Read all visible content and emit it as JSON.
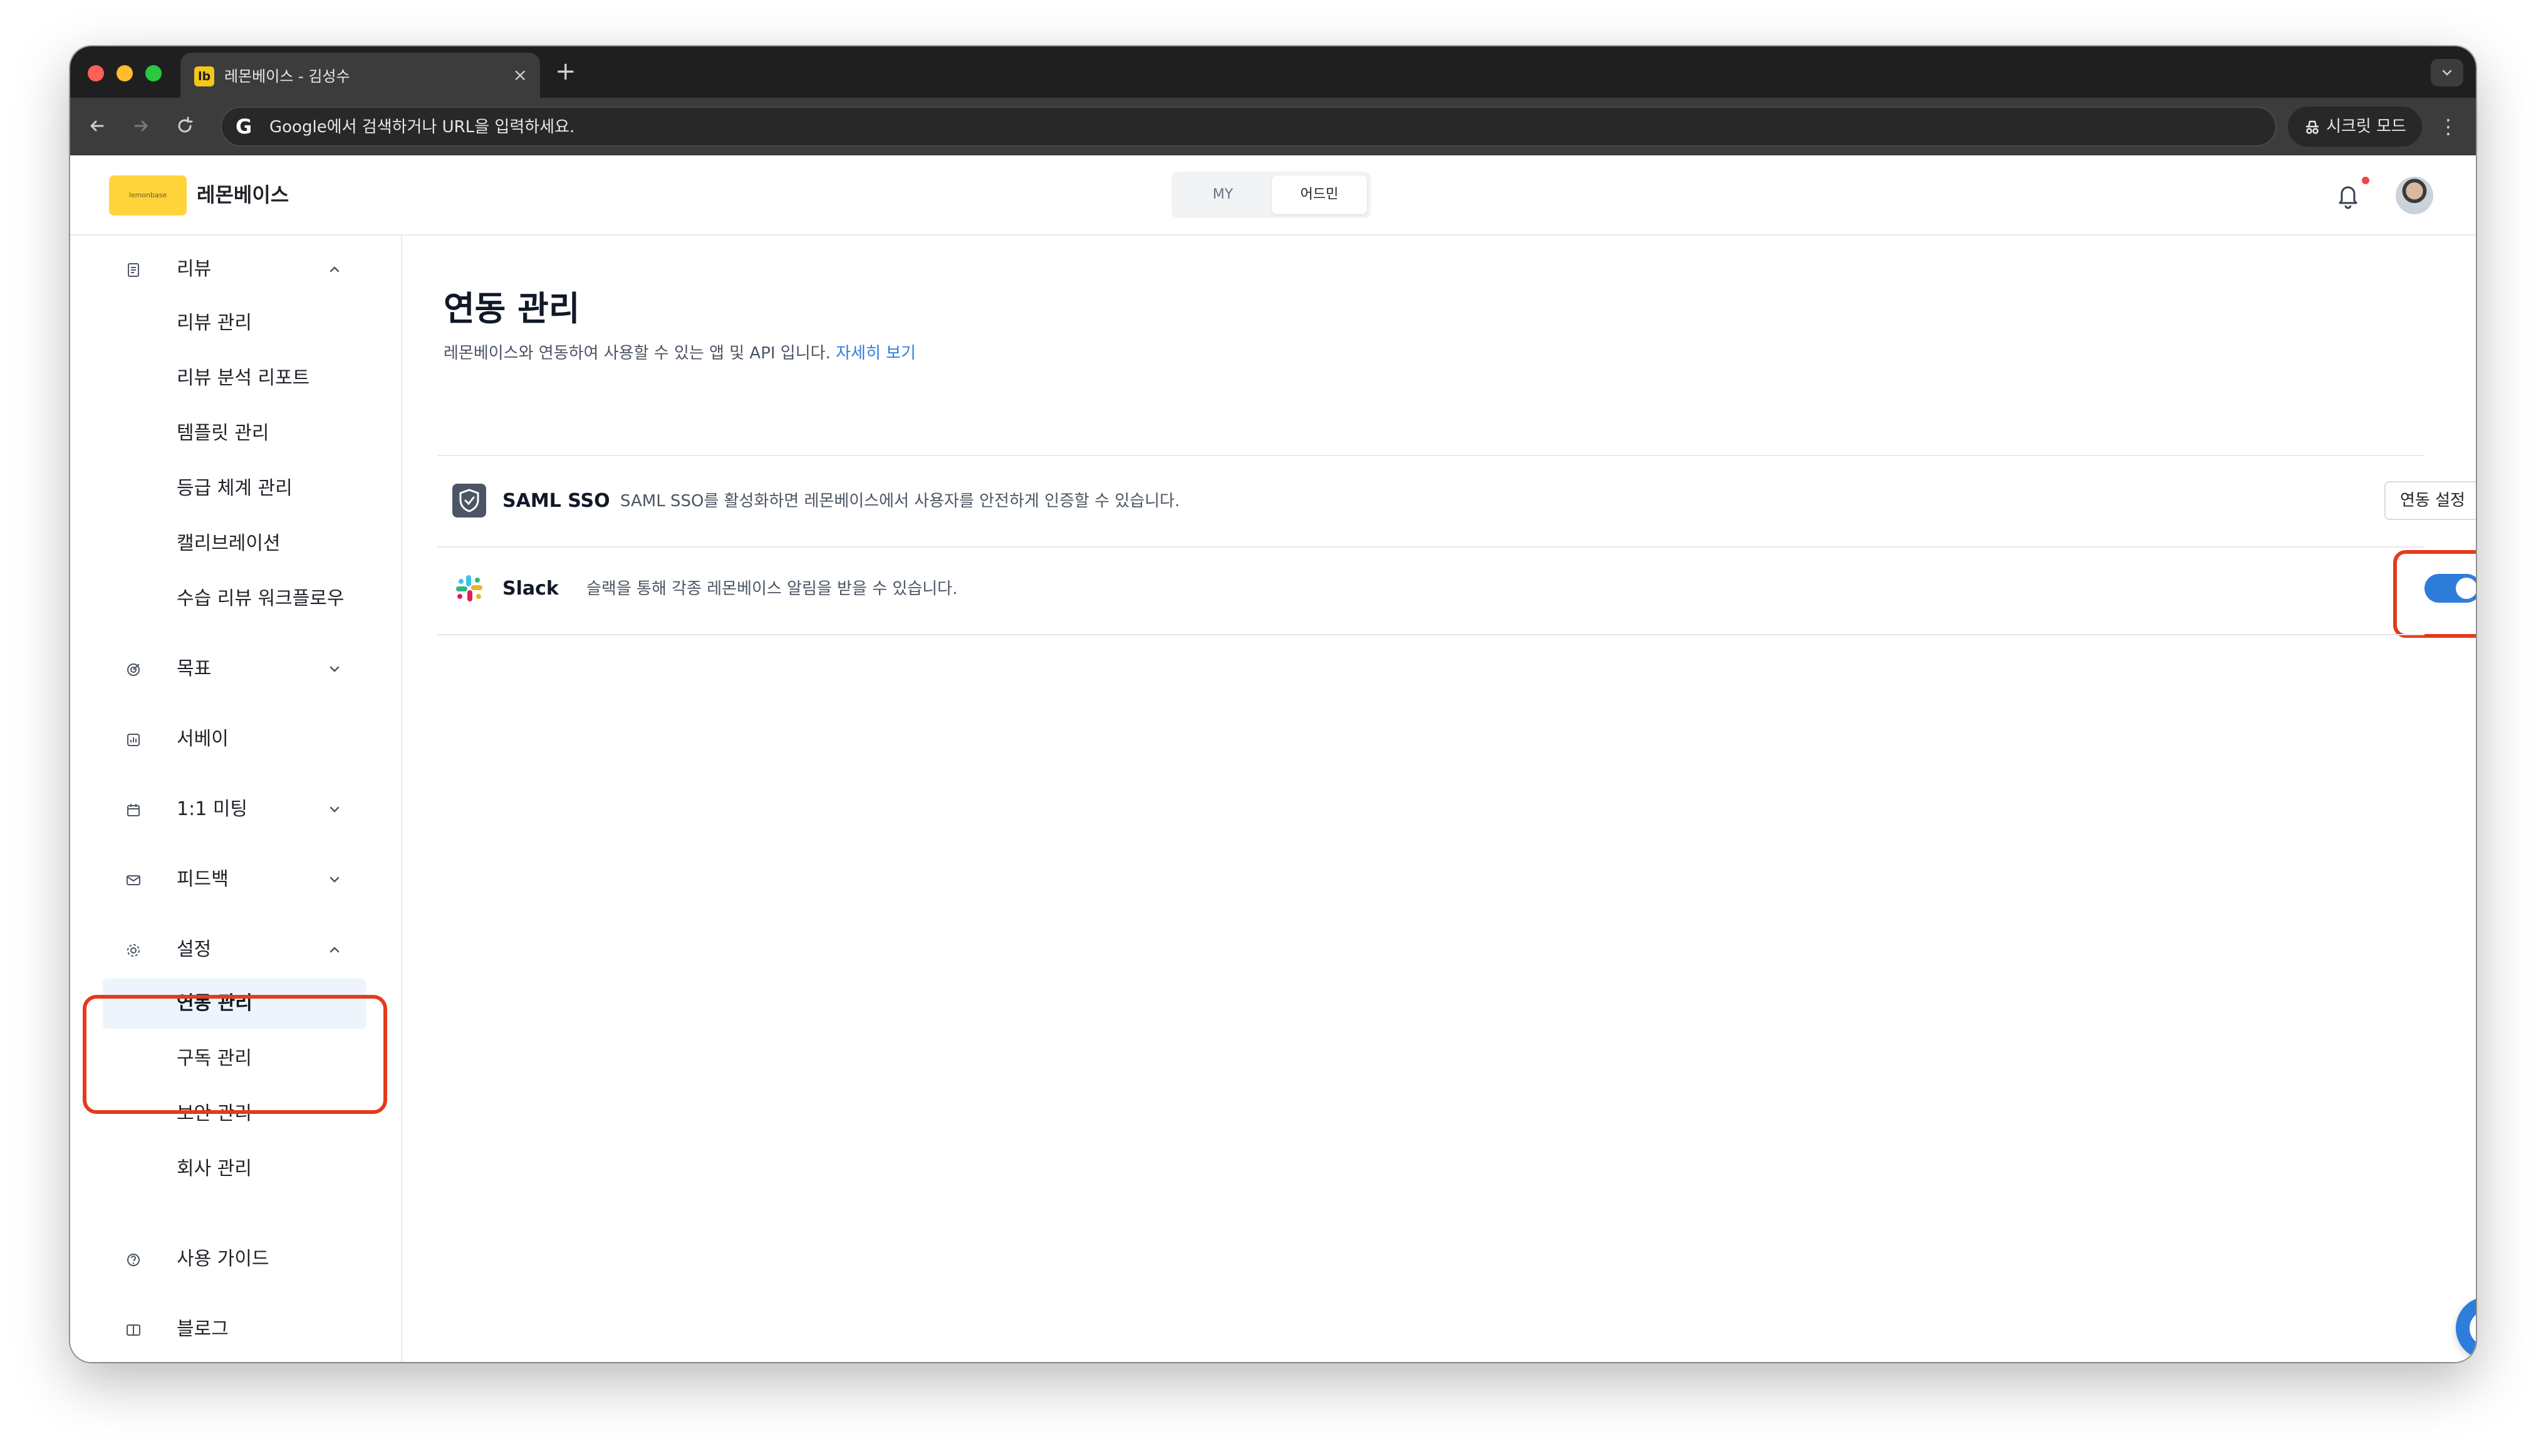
{
  "browser": {
    "tab_title": "레몬베이스 - 김성수",
    "favicon_text": "lb",
    "tab_close": "×",
    "new_tab": "+",
    "omnibox_text": "Google에서 검색하거나 URL을 입력하세요.",
    "incognito_label": "시크릿 모드"
  },
  "header": {
    "logo_text": "lemonbase",
    "brand": "레몬베이스",
    "mode_tabs": [
      "MY",
      "어드민"
    ],
    "active_mode": "어드민"
  },
  "sidebar": {
    "review": {
      "label": "리뷰",
      "subitems": [
        "리뷰 관리",
        "리뷰 분석 리포트",
        "템플릿 관리",
        "등급 체계 관리",
        "캘리브레이션",
        "수습 리뷰 워크플로우"
      ]
    },
    "goal": "목표",
    "survey": "서베이",
    "meeting": "1:1 미팅",
    "feedback": "피드백",
    "settings": {
      "label": "설정",
      "subitems": [
        "연동 관리",
        "구독 관리",
        "보안 관리",
        "회사 관리"
      ],
      "active": "연동 관리"
    },
    "guide": "사용 가이드",
    "blog": "블로그"
  },
  "main": {
    "title": "연동 관리",
    "description": "레몬베이스와 연동하여 사용할 수 있는 앱 및 API 입니다.",
    "learn_more": "자세히 보기",
    "integrations": [
      {
        "name": "SAML SSO",
        "description": "SAML SSO를 활성화하면 레몬베이스에서 사용자를 안전하게 인증할 수 있습니다.",
        "action_label": "연동 설정"
      },
      {
        "name": "Slack",
        "description": "슬랙을 통해 각종 레몬베이스 알림을 받을 수 있습니다.",
        "enabled": true
      }
    ]
  },
  "colors": {
    "accent": "#2f7ddb",
    "highlight": "#e53a1c",
    "logo": "#ffd43b"
  }
}
